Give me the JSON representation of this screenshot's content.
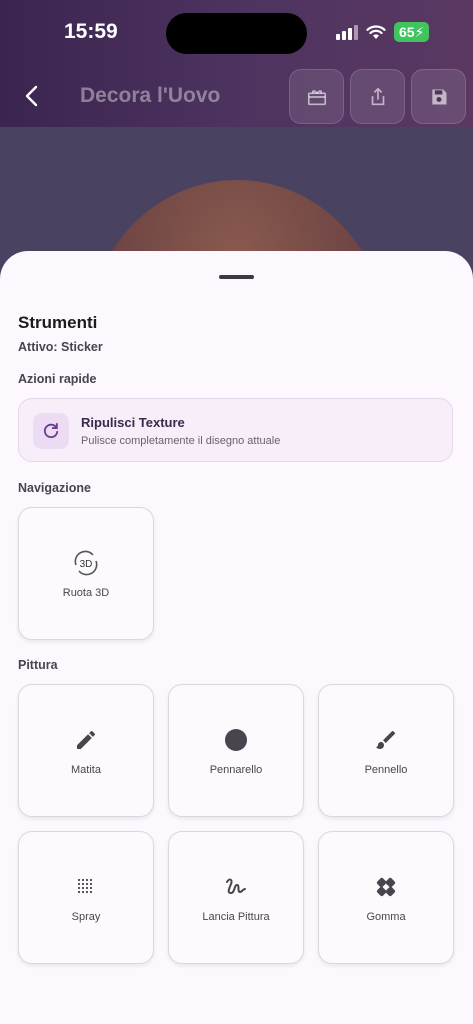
{
  "status_bar": {
    "time": "15:59",
    "battery": "65"
  },
  "header": {
    "title": "Decora l'Uovo"
  },
  "sheet": {
    "title": "Strumenti",
    "active": "Attivo: Sticker",
    "quick_actions_label": "Azioni rapide",
    "quick_action": {
      "title": "Ripulisci Texture",
      "subtitle": "Pulisce completamente il disegno attuale",
      "icon": "refresh-icon"
    },
    "navigation_label": "Navigazione",
    "navigation_tools": [
      {
        "label": "Ruota 3D",
        "icon": "rotate-3d-icon"
      }
    ],
    "painting_label": "Pittura",
    "painting_tools": [
      {
        "label": "Matita",
        "icon": "pencil-icon"
      },
      {
        "label": "Pennarello",
        "icon": "circle-icon"
      },
      {
        "label": "Pennello",
        "icon": "brush-icon"
      },
      {
        "label": "Spray",
        "icon": "spray-icon"
      },
      {
        "label": "Lancia Pittura",
        "icon": "squiggle-icon"
      },
      {
        "label": "Gomma",
        "icon": "eraser-icon"
      }
    ]
  },
  "colors": {
    "accent": "#6b3d8c",
    "sheet_bg": "#fcf8fd"
  }
}
